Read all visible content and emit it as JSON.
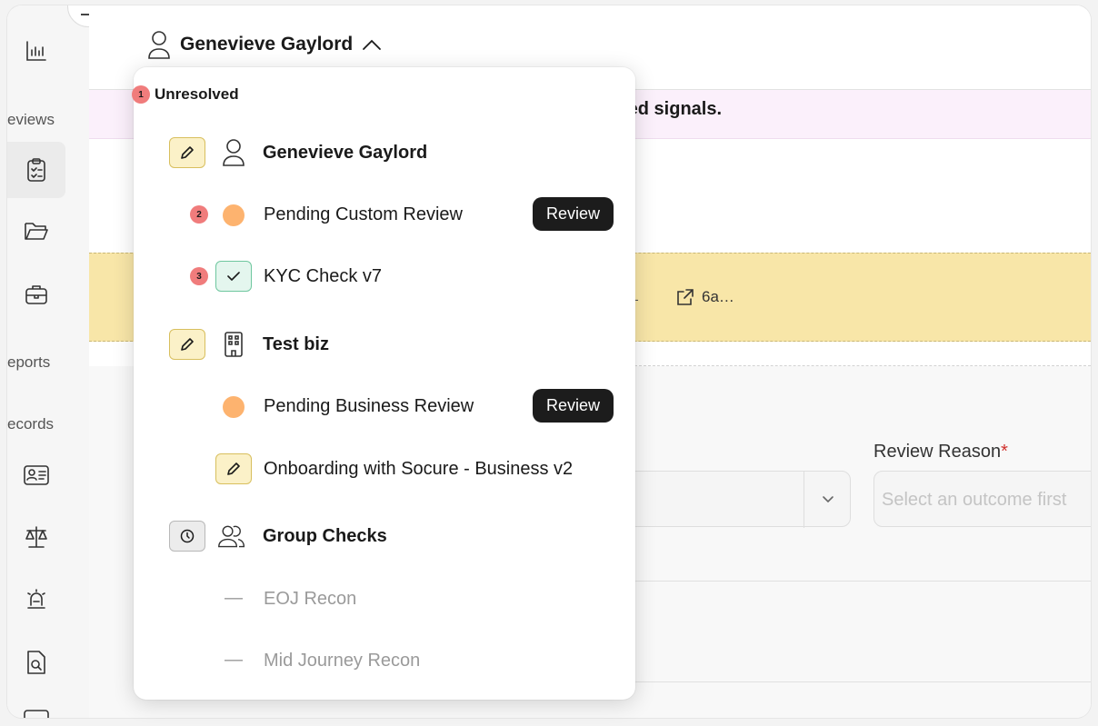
{
  "header": {
    "title": "Genevieve Gaylord"
  },
  "sidebar": {
    "labels": {
      "reviews": "eviews",
      "reports": "eports",
      "records": "ecords"
    }
  },
  "background": {
    "pink_banner_text": "ted signals.",
    "yellow_banner": {
      "dash": "-",
      "link_text": "6a…"
    },
    "review_reason": {
      "label": "Review Reason",
      "required_mark": "*",
      "placeholder": "Select an outcome first"
    }
  },
  "dropdown": {
    "section_step": "1",
    "section_label": "Unresolved",
    "rows": [
      {
        "label": "Genevieve Gaylord"
      },
      {
        "step": "2",
        "label": "Pending Custom Review",
        "action": "Review"
      },
      {
        "step": "3",
        "label": "KYC Check v7"
      },
      {
        "label": "Test biz"
      },
      {
        "label": "Pending Business Review",
        "action": "Review"
      },
      {
        "label": "Onboarding with Socure - Business v2"
      },
      {
        "label": "Group Checks"
      },
      {
        "dash": "—",
        "label": "EOJ Recon"
      },
      {
        "dash": "—",
        "label": "Mid Journey Recon"
      }
    ]
  },
  "colors": {
    "pending_dot": "#fdb36f",
    "step_badge": "#f07c7c",
    "pencil_bg": "#fbf1c8",
    "check_bg": "#e4f6ee",
    "review_button": "#1c1c1c",
    "yellow_banner": "#f8e6a8",
    "pink_banner": "#fbf0fb"
  }
}
